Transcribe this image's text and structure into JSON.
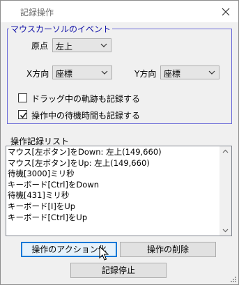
{
  "window": {
    "title": "記録操作"
  },
  "mouse_group": {
    "legend": "マウスカーソルのイベント",
    "origin_label": "原点",
    "origin_value": "左上",
    "xdir_label": "X方向",
    "xdir_value": "座標",
    "ydir_label": "Y方向",
    "ydir_value": "座標",
    "drag_trail": {
      "label": "ドラッグ中の軌跡も記録する",
      "checked": false
    },
    "wait_time": {
      "label": "操作中の待機時間も記録する",
      "checked": true
    }
  },
  "record_list": {
    "label": "操作記録リスト",
    "items": [
      "マウス[左ボタン]をDown: 左上(149,660)",
      "マウス[左ボタン]をUp: 左上(149,660)",
      "待機[3000]ミリ秒",
      "キーボード[Ctrl]をDown",
      "待機[431]ミリ秒",
      "キーボード[I]をUp",
      "キーボード[Ctrl]をUp"
    ]
  },
  "buttons": {
    "action": "操作のアクション化",
    "delete": "操作の削除",
    "stop": "記録停止"
  },
  "icons": {
    "close": "close-icon",
    "chevron": "chevron-down-icon",
    "check": "check-icon",
    "scroll_up": "scroll-up-arrow-icon",
    "scroll_down": "scroll-down-arrow-icon",
    "cursor": "mouse-pointer-icon",
    "grip": "resize-grip-icon"
  },
  "colors": {
    "group_border": "#6b6bd8",
    "group_legend": "#0f0fa8",
    "focus_border": "#0078d7"
  }
}
